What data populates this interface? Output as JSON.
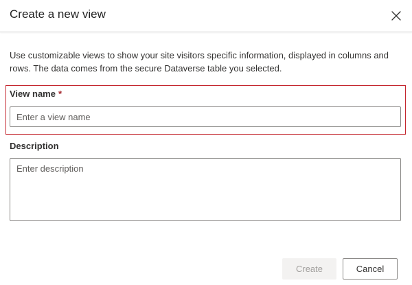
{
  "dialog": {
    "title": "Create a new view",
    "close_icon": "close-icon",
    "intro": "Use customizable views to show your site visitors specific information, displayed in columns and rows. The data comes from the secure Dataverse table you selected."
  },
  "form": {
    "view_name": {
      "label": "View name",
      "required_marker": "*",
      "value": "",
      "placeholder": "Enter a view name"
    },
    "description": {
      "label": "Description",
      "value": "",
      "placeholder": "Enter description"
    }
  },
  "actions": {
    "create_label": "Create",
    "create_disabled": true,
    "cancel_label": "Cancel"
  },
  "colors": {
    "highlight_border": "#c4262e",
    "required": "#a4262c",
    "disabled_bg": "#f3f2f1",
    "disabled_text": "#a19f9d"
  }
}
